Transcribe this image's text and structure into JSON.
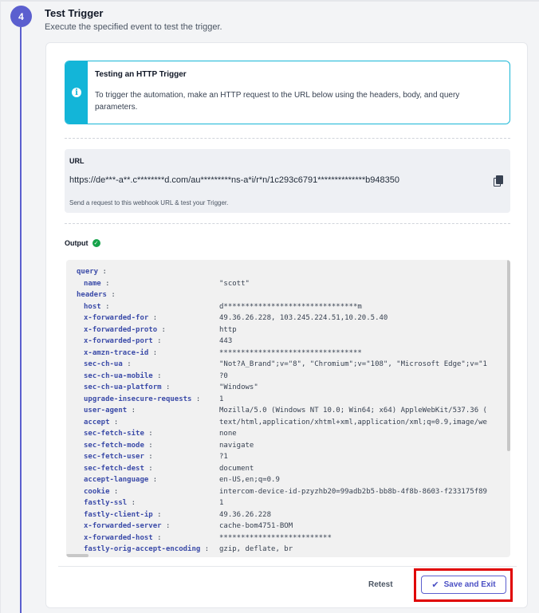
{
  "step": {
    "number": "4",
    "title": "Test Trigger",
    "subtitle": "Execute the specified event to test the trigger."
  },
  "info": {
    "icon": "info-icon",
    "title": "Testing an HTTP Trigger",
    "body": "To trigger the automation, make an HTTP request to the URL below using the headers, body, and query parameters."
  },
  "url_section": {
    "label": "URL",
    "value": "https://de***-a**.c********d.com/au*********ns-a*i/r*n/1c293c6791**************b948350",
    "hint": "Send a request to this webhook URL & test your Trigger."
  },
  "output": {
    "label": "Output",
    "status_icon": "check-circle-icon",
    "rows": [
      {
        "key": "query",
        "value": "",
        "indent": 0
      },
      {
        "key": "name",
        "value": "\"scott\"",
        "indent": 1
      },
      {
        "key": "headers",
        "value": "",
        "indent": 0
      },
      {
        "key": "host",
        "value": "d*******************************m",
        "indent": 1
      },
      {
        "key": "x-forwarded-for",
        "value": "49.36.26.228, 103.245.224.51,10.20.5.40",
        "indent": 1
      },
      {
        "key": "x-forwarded-proto",
        "value": "http",
        "indent": 1
      },
      {
        "key": "x-forwarded-port",
        "value": "443",
        "indent": 1
      },
      {
        "key": "x-amzn-trace-id",
        "value": "*********************************",
        "indent": 1
      },
      {
        "key": "sec-ch-ua",
        "value": "\"Not?A_Brand\";v=\"8\", \"Chromium\";v=\"108\", \"Microsoft Edge\";v=\"1",
        "indent": 1
      },
      {
        "key": "sec-ch-ua-mobile",
        "value": "?0",
        "indent": 1
      },
      {
        "key": "sec-ch-ua-platform",
        "value": "\"Windows\"",
        "indent": 1
      },
      {
        "key": "upgrade-insecure-requests",
        "value": "1",
        "indent": 1
      },
      {
        "key": "user-agent",
        "value": "Mozilla/5.0 (Windows NT 10.0; Win64; x64) AppleWebKit/537.36 (",
        "indent": 1
      },
      {
        "key": "accept",
        "value": "text/html,application/xhtml+xml,application/xml;q=0.9,image/we",
        "indent": 1
      },
      {
        "key": "sec-fetch-site",
        "value": "none",
        "indent": 1
      },
      {
        "key": "sec-fetch-mode",
        "value": "navigate",
        "indent": 1
      },
      {
        "key": "sec-fetch-user",
        "value": "?1",
        "indent": 1
      },
      {
        "key": "sec-fetch-dest",
        "value": "document",
        "indent": 1
      },
      {
        "key": "accept-language",
        "value": "en-US,en;q=0.9",
        "indent": 1
      },
      {
        "key": "cookie",
        "value": "intercom-device-id-pzyzhb20=99adb2b5-bb8b-4f8b-8603-f233175f89",
        "indent": 1
      },
      {
        "key": "fastly-ssl",
        "value": "1",
        "indent": 1
      },
      {
        "key": "fastly-client-ip",
        "value": "49.36.26.228",
        "indent": 1
      },
      {
        "key": "x-forwarded-server",
        "value": "cache-bom4751-BOM",
        "indent": 1
      },
      {
        "key": "x-forwarded-host",
        "value": "**************************",
        "indent": 1
      },
      {
        "key": "fastly-orig-accept-encoding",
        "value": "gzip, deflate, br",
        "indent": 1
      }
    ]
  },
  "footer": {
    "retest_label": "Retest",
    "save_label": "Save and Exit"
  },
  "colors": {
    "accent": "#5b5fcf",
    "info": "#13b5d8",
    "success": "#16a34a",
    "highlight": "#e00000"
  }
}
